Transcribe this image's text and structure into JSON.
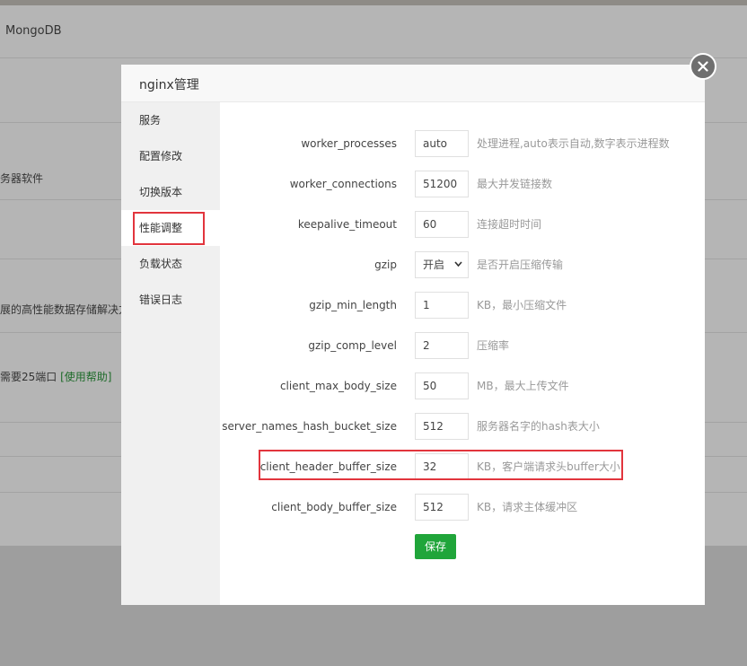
{
  "background": {
    "header_text": "MongoDB",
    "text1": "务器软件",
    "text2": "展的高性能数据存储解决方",
    "text3": "需要25端口",
    "text3_link": "[使用帮助]"
  },
  "modal": {
    "title": "nginx管理",
    "close_icon": "close-icon"
  },
  "sidebar": {
    "items": [
      {
        "label": "服务"
      },
      {
        "label": "配置修改"
      },
      {
        "label": "切换版本"
      },
      {
        "label": "性能调整"
      },
      {
        "label": "负载状态"
      },
      {
        "label": "错误日志"
      }
    ],
    "active_index": 3
  },
  "form": {
    "rows": [
      {
        "label": "worker_processes",
        "value": "auto",
        "hint": "处理进程,auto表示自动,数字表示进程数"
      },
      {
        "label": "worker_connections",
        "value": "51200",
        "hint": "最大并发链接数"
      },
      {
        "label": "keepalive_timeout",
        "value": "60",
        "hint": "连接超时时间"
      },
      {
        "label": "gzip",
        "value": "开启",
        "hint": "是否开启压缩传输"
      },
      {
        "label": "gzip_min_length",
        "value": "1",
        "hint": "KB，最小压缩文件"
      },
      {
        "label": "gzip_comp_level",
        "value": "2",
        "hint": "压缩率"
      },
      {
        "label": "client_max_body_size",
        "value": "50",
        "hint": "MB，最大上传文件"
      },
      {
        "label": "server_names_hash_bucket_size",
        "value": "512",
        "hint": "服务器名字的hash表大小"
      },
      {
        "label": "client_header_buffer_size",
        "value": "32",
        "hint": "KB，客户端请求头buffer大小"
      },
      {
        "label": "client_body_buffer_size",
        "value": "512",
        "hint": "KB，请求主体缓冲区"
      }
    ],
    "save_label": "保存"
  },
  "colors": {
    "accent": "#20a53a",
    "highlight": "#e2353d"
  }
}
